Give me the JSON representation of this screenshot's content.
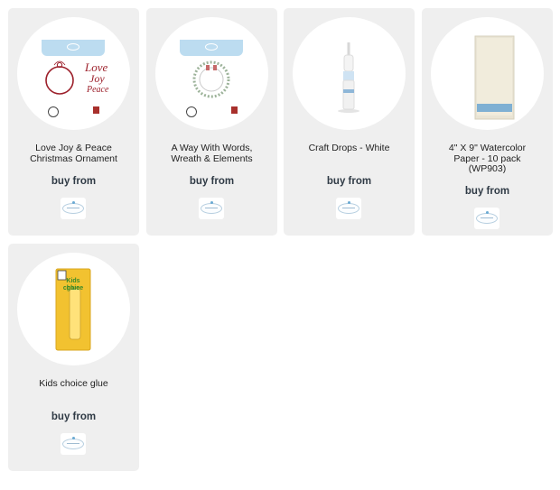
{
  "products": [
    {
      "title_line1": "Love Joy & Peace",
      "title_line2": "Christmas Ornament",
      "buy_label": "buy from",
      "retailer_icon": "elizabeth-craft-designs-logo",
      "image_text": [
        "Love",
        "Joy",
        "Peace"
      ]
    },
    {
      "title_line1": "A Way With Words,",
      "title_line2": "Wreath & Elements",
      "buy_label": "buy from",
      "retailer_icon": "elizabeth-craft-designs-logo"
    },
    {
      "title_line1": "Craft Drops - White",
      "buy_label": "buy from",
      "retailer_icon": "elizabeth-craft-designs-logo"
    },
    {
      "title_line1": "4\" X 9\" Watercolor",
      "title_line2": "Paper - 10 pack",
      "title_line3": "(WP903)",
      "buy_label": "buy from",
      "retailer_icon": "elizabeth-craft-designs-logo"
    },
    {
      "title_line1": "Kids choice glue",
      "buy_label": "buy from",
      "retailer_icon": "elizabeth-craft-designs-logo",
      "image_text": [
        "Kids choice",
        "glue"
      ]
    }
  ],
  "colors": {
    "card_bg": "#efefef",
    "buy_text": "#2f3a45",
    "package_blue": "#bcdcf0",
    "ornament_red": "#9c1f2a",
    "glue_yellow": "#f2c230"
  }
}
